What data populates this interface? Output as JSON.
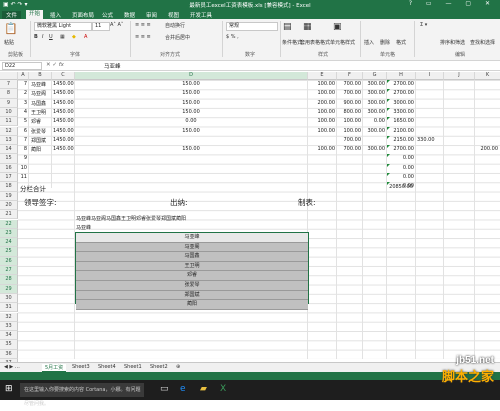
{
  "window": {
    "title": "最新员工excel工资表模板.xls [兼容模式] - Excel"
  },
  "menu_tabs": [
    "文件",
    "开始",
    "插入",
    "页面布局",
    "公式",
    "数据",
    "审阅",
    "视图",
    "开发工具"
  ],
  "ribbon": {
    "font_name": "微软雅黑 Light",
    "font_size": "11",
    "number_format": "常规",
    "groups": [
      "剪贴板",
      "字体",
      "对齐方式",
      "数字",
      "样式",
      "单元格",
      "编辑"
    ],
    "buttons": [
      "粘贴",
      "条件格式",
      "套用表格格式",
      "单元格样式",
      "插入",
      "删除",
      "格式",
      "排序和筛选",
      "查找和选择",
      "自动换行",
      "合并后居中"
    ]
  },
  "formula_bar": {
    "name_box": "D22",
    "fx": "fx",
    "value": "马亚峰"
  },
  "columns": [
    "A",
    "B",
    "C",
    "D",
    "E",
    "F",
    "G",
    "H",
    "I",
    "J",
    "K"
  ],
  "selected_column": "D",
  "rows": [
    {
      "n": "7",
      "name": "马亚峰",
      "c": "1450.00",
      "d": "150.00",
      "e": "100.00",
      "f": "700.00",
      "g": "300.00",
      "h": "2700.00",
      "i": "",
      "k": ""
    },
    {
      "n": "2",
      "name": "马亚阁",
      "c": "1450.00",
      "d": "150.00",
      "e": "100.00",
      "f": "700.00",
      "g": "300.00",
      "h": "2700.00",
      "i": "",
      "k": ""
    },
    {
      "n": "3",
      "name": "马国鑫",
      "c": "1450.00",
      "d": "150.00",
      "e": "200.00",
      "f": "900.00",
      "g": "300.00",
      "h": "3000.00",
      "i": "",
      "k": ""
    },
    {
      "n": "4",
      "name": "王卫明",
      "c": "1450.00",
      "d": "150.00",
      "e": "100.00",
      "f": "800.00",
      "g": "300.00",
      "h": "3300.00",
      "i": "",
      "k": ""
    },
    {
      "n": "5",
      "name": "邓睿",
      "c": "1450.00",
      "d": "0.00",
      "e": "100.00",
      "f": "100.00",
      "g": "0.00",
      "h": "1650.00",
      "i": "",
      "k": ""
    },
    {
      "n": "6",
      "name": "张爱琴",
      "c": "1450.00",
      "d": "150.00",
      "e": "100.00",
      "f": "100.00",
      "g": "300.00",
      "h": "2100.00",
      "i": "",
      "k": ""
    },
    {
      "n": "7",
      "name": "郑国斌",
      "c": "1450.00",
      "d": "",
      "e": "",
      "f": "700.00",
      "g": "",
      "h": "2150.00",
      "i": "330.00",
      "k": ""
    },
    {
      "n": "8",
      "name": "蔺阳",
      "c": "1450.00",
      "d": "150.00",
      "e": "100.00",
      "f": "700.00",
      "g": "300.00",
      "h": "2700.00",
      "i": "",
      "k": "200.00"
    },
    {
      "n": "9",
      "name": "",
      "c": "",
      "d": "",
      "e": "",
      "f": "",
      "g": "",
      "h": "0.00",
      "i": "",
      "k": ""
    },
    {
      "n": "10",
      "name": "",
      "c": "",
      "d": "",
      "e": "",
      "f": "",
      "g": "",
      "h": "0.00",
      "i": "",
      "k": ""
    },
    {
      "n": "11",
      "name": "",
      "c": "",
      "d": "",
      "e": "",
      "f": "",
      "g": "",
      "h": "0.00",
      "i": "",
      "k": ""
    },
    {
      "n": "",
      "name": "",
      "c": "",
      "d": "",
      "e": "",
      "f": "",
      "g": "",
      "h": "0.00",
      "i": "",
      "k": ""
    }
  ],
  "row_headers": [
    "7",
    "8",
    "9",
    "10",
    "11",
    "12",
    "13",
    "14",
    "15",
    "16",
    "17",
    "18",
    "19",
    "20",
    "21",
    "22",
    "23",
    "24",
    "25",
    "26",
    "27",
    "28",
    "29",
    "30",
    "31",
    "32",
    "33",
    "34",
    "35",
    "36",
    "37"
  ],
  "subtotal": {
    "label": "分栏合计",
    "value": "20850.00"
  },
  "signature": {
    "leader": "领导签字:",
    "cashier": "出纳:",
    "maker": "制表:"
  },
  "concat_text": "马亚峰马亚阁马国鑫王卫明邓睿张爱琴郑国斌蔺阳",
  "concat_first": "马亚峰",
  "name_list": [
    "马亚峰",
    "马亚阁",
    "马国鑫",
    "王卫明",
    "邓睿",
    "张爱琴",
    "郑国斌",
    "蔺阳"
  ],
  "sheet_tabs": [
    "5月工资",
    "Sheet3",
    "Sheet4",
    "Sheet1",
    "Sheet2"
  ],
  "active_sheet": "5月工资",
  "taskbar": {
    "search": "在这里输入你要搜索的内容 Cortana，小娜。有问题尽管问我。"
  },
  "watermark": {
    "line1": "jb51.net",
    "line2": "脚本之家"
  }
}
